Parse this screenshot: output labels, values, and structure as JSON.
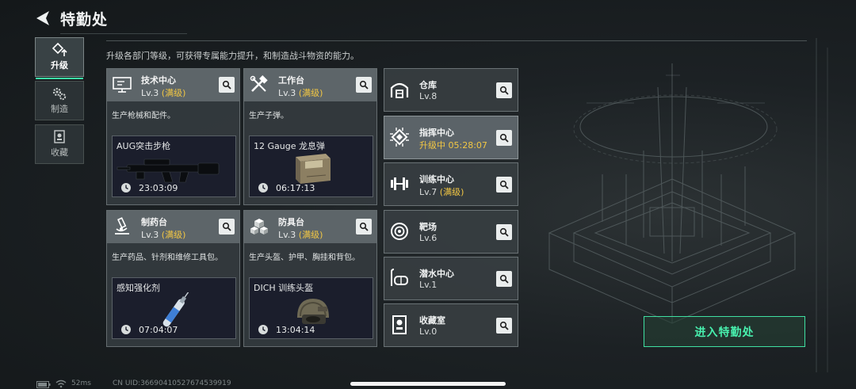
{
  "header": {
    "title": "特勤处"
  },
  "nav": [
    {
      "label": "升级",
      "icon": "upgrade-icon",
      "active": true
    },
    {
      "label": "制造",
      "icon": "gears-icon",
      "active": false
    },
    {
      "label": "收藏",
      "icon": "trophy-icon",
      "active": false
    }
  ],
  "subtitle": "升级各部门等级，可获得专属能力提升，和制造战斗物资的能力。",
  "cards": [
    {
      "name": "技术中心",
      "level": "Lv.3",
      "max": "(满级)",
      "desc": "生产枪械和配件。",
      "item": "AUG突击步枪",
      "timer": "23:03:09"
    },
    {
      "name": "工作台",
      "level": "Lv.3",
      "max": "(满级)",
      "desc": "生产子弹。",
      "item": "12 Gauge 龙息弹",
      "timer": "06:17:13"
    },
    {
      "name": "制药台",
      "level": "Lv.3",
      "max": "(满级)",
      "desc": "生产药品、针剂和维修工具包。",
      "item": "感知强化剂",
      "timer": "07:04:07"
    },
    {
      "name": "防具台",
      "level": "Lv.3",
      "max": "(满级)",
      "desc": "生产头盔、护甲、胸挂和背包。",
      "item": "DICH 训练头盔",
      "timer": "13:04:14"
    }
  ],
  "side": [
    {
      "name": "仓库",
      "level": "Lv.8",
      "max": ""
    },
    {
      "name": "指挥中心",
      "level": "升级中 05:28:07",
      "max": ""
    },
    {
      "name": "训练中心",
      "level": "Lv.7",
      "max": "(满级)"
    },
    {
      "name": "靶场",
      "level": "Lv.6",
      "max": ""
    },
    {
      "name": "潜水中心",
      "level": "Lv.1",
      "max": ""
    },
    {
      "name": "收藏室",
      "level": "Lv.0",
      "max": ""
    }
  ],
  "enter_button": "进入特勤处",
  "footer": {
    "ping": "52ms",
    "uid": "CN UID:366904105276745399​19"
  },
  "colors": {
    "accent": "#3ee8a8",
    "max_level": "#f2c744"
  }
}
